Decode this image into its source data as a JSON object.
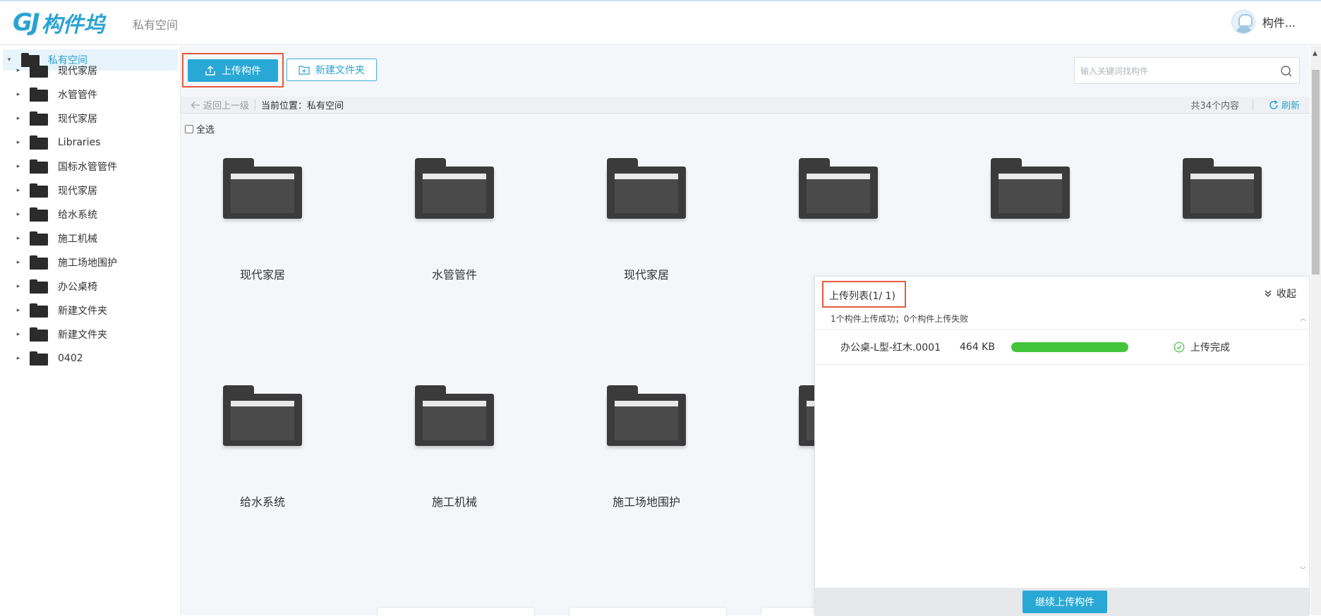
{
  "header": {
    "logo_letters": "GJ",
    "logo_text": "构件坞",
    "space_title": "私有空间",
    "user_name": "构件..."
  },
  "sidebar": {
    "root": "私有空间",
    "items": [
      {
        "label": "现代家居"
      },
      {
        "label": "水管管件"
      },
      {
        "label": "现代家居"
      },
      {
        "label": "Libraries"
      },
      {
        "label": "国标水管管件"
      },
      {
        "label": "现代家居"
      },
      {
        "label": "给水系统"
      },
      {
        "label": "施工机械"
      },
      {
        "label": "施工场地围护"
      },
      {
        "label": "办公桌椅"
      },
      {
        "label": "新建文件夹"
      },
      {
        "label": "新建文件夹"
      },
      {
        "label": "0402"
      }
    ]
  },
  "toolbar": {
    "upload_label": "上传构件",
    "new_folder_label": "新建文件夹",
    "search_placeholder": "输入关键词找构件"
  },
  "navbar": {
    "back_label": "返回上一级",
    "location": "当前位置：私有空间",
    "count": "共34个内容",
    "refresh_label": "刷新"
  },
  "select_all_label": "全选",
  "folders": [
    {
      "name": "现代家居"
    },
    {
      "name": "水管管件"
    },
    {
      "name": "现代家居"
    },
    {
      "name": ""
    },
    {
      "name": ""
    },
    {
      "name": ""
    },
    {
      "name": "给水系统"
    },
    {
      "name": "施工机械"
    },
    {
      "name": "施工场地围护"
    },
    {
      "name": ""
    }
  ],
  "upload_panel": {
    "title": "上传列表(1/ 1)",
    "collapse_label": "收起",
    "summary": "1个构件上传成功；0个构件上传失败",
    "files": [
      {
        "name": "办公桌-L型-红木.0001",
        "size": "464 KB",
        "progress": 1.0,
        "status": "上传完成"
      }
    ],
    "continue_label": "继续上传构件"
  },
  "colors": {
    "accent": "#2aa8d5",
    "highlight_border": "#e45b3c",
    "progress": "#44c43b",
    "folder": "#3b3b3b"
  }
}
